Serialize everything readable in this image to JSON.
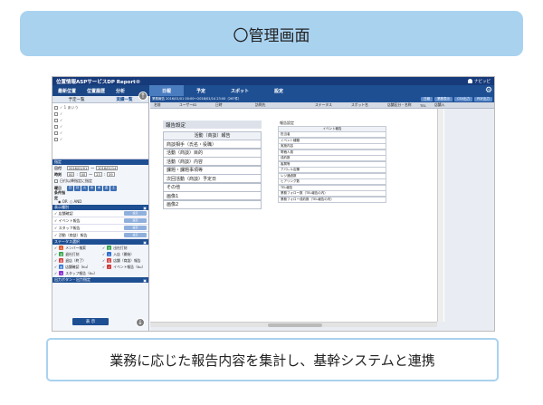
{
  "banner": {
    "title": "〇管理画面"
  },
  "app": {
    "title": "位置情報ASPサービスDP Report®",
    "user_name": "ナビッピ",
    "left_menu": [
      "最新位置",
      "位置履歴",
      "分析"
    ],
    "tabs": [
      "日報",
      "予定",
      "スポット",
      "設定"
    ],
    "left_header": {
      "tab1": "予定一覧",
      "tab2": "実績一覧"
    },
    "list_checks": [
      "✓ 1 あいう",
      "✓",
      "✓",
      "✓",
      "✓",
      "✓"
    ],
    "period": {
      "section_label": "指定",
      "date_label": "日付",
      "date_from": "2016/01/01",
      "date_to": "2016/01/14",
      "time_label": "時刻",
      "time_from_h": "00",
      "time_from_m": "00",
      "time_to_h": "23",
      "time_to_m": "59",
      "checkbox_label": "日付以降指定に指定",
      "weekday_label": "曜日",
      "weekdays": [
        "日",
        "月",
        "火",
        "水",
        "木",
        "金",
        "土"
      ],
      "logic_label": "条件指定",
      "logic_or": "OR",
      "logic_and": "AND"
    },
    "display_section": "表示種別",
    "display_items": [
      "店舗確認",
      "イベント報告",
      "スタッフ報告",
      "活動（商談）報告"
    ],
    "display_btn": "設定",
    "status_section": "ステータス選択",
    "status_items": [
      {
        "label": "メンバー検索",
        "color": "#e05a2b",
        "icon": "人"
      },
      {
        "label": "出社打刻",
        "color": "#2ea043",
        "icon": "出"
      },
      {
        "label": "退社打刻",
        "color": "#2ea043",
        "icon": "退"
      },
      {
        "label": "入店（開始）",
        "color": "#2f6fd0",
        "icon": "入"
      },
      {
        "label": "退店（終了）",
        "color": "#d23a3a",
        "icon": "退"
      },
      {
        "label": "店舗（商談）報告",
        "color": "#d23a3a",
        "icon": "店"
      },
      {
        "label": "店舗確認（Ku）",
        "color": "#2f6fd0",
        "icon": "確"
      },
      {
        "label": "イベント報告（Ku）",
        "color": "#d23a3a",
        "icon": "イ"
      },
      {
        "label": "スタッフ報告（Ku）",
        "color": "#8a2fd0",
        "icon": "ス"
      }
    ],
    "output_label": "出力ボタン・出力指定",
    "show_button": "表 示",
    "info_text": "業務報告 2016/01/01 00:00～2016/01/14 23:00（267件）",
    "info_buttons": [
      "日報",
      "業務表示",
      "CSV出力",
      "PDF出力"
    ],
    "table_headers": [
      "名前",
      "ユーザーID",
      "日時",
      "訪問先",
      "ステータス",
      "スポット名",
      "店舗区分・名称",
      "TEL",
      "店舗入"
    ],
    "report_panel": {
      "title": "報告設定",
      "items": [
        "活動（商談）報告",
        "商談相手（氏名・役職）",
        "活動（商談）目的",
        "活動（商談）内容",
        "課題・課題事項等",
        "次回活動（商談）予定日",
        "その他",
        "画像1",
        "画像2"
      ]
    },
    "sub_panel": {
      "title": "報告設定",
      "items": [
        "イベント報告",
        "担当者",
        "イベント種類",
        "実施内容",
        "寄稿人員",
        "成約数",
        "客層等",
        "アパレル店舗",
        "レジ通過数",
        "ヒアリング数",
        "TEL報告",
        "業務フォロー数（TEL報告の内）",
        "業務フォロー成約数（TEL報告の内）"
      ]
    }
  },
  "caption": "業務に応じた報告内容を集計し、基幹システムと連携"
}
